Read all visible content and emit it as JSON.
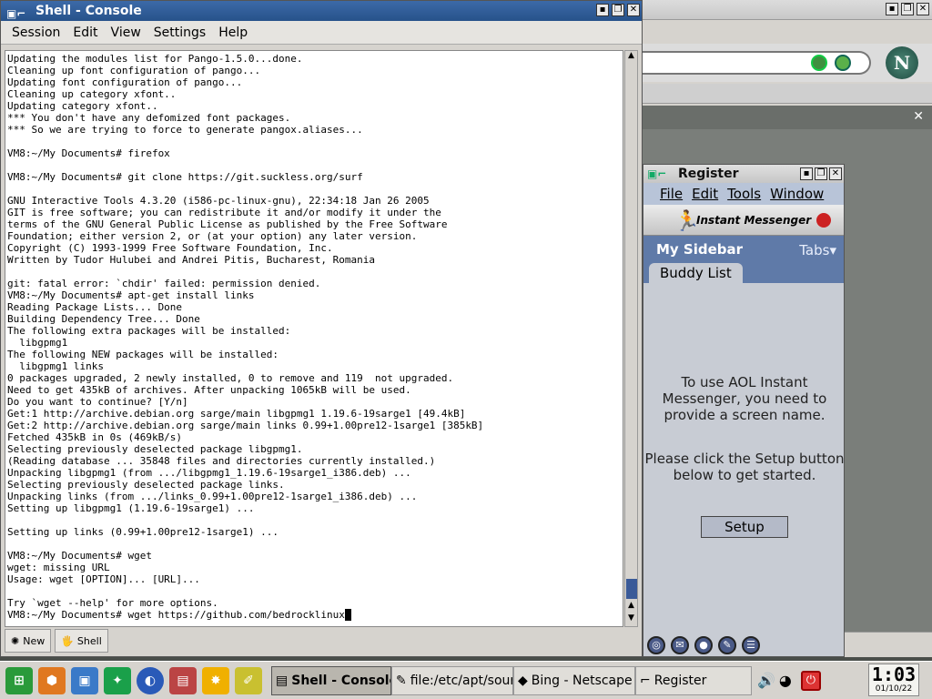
{
  "console": {
    "title": "Shell - Console",
    "menu": [
      "Session",
      "Edit",
      "View",
      "Settings",
      "Help"
    ],
    "lines": [
      "Updating the modules list for Pango-1.5.0...done.",
      "Cleaning up font configuration of pango...",
      "Updating font configuration of pango...",
      "Cleaning up category xfont..",
      "Updating category xfont..",
      "*** You don't have any defomized font packages.",
      "*** So we are trying to force to generate pangox.aliases...",
      "",
      "VM8:~/My Documents# firefox",
      "",
      "VM8:~/My Documents# git clone https://git.suckless.org/surf",
      "",
      "GNU Interactive Tools 4.3.20 (i586-pc-linux-gnu), 22:34:18 Jan 26 2005",
      "GIT is free software; you can redistribute it and/or modify it under the",
      "terms of the GNU General Public License as published by the Free Software",
      "Foundation; either version 2, or (at your option) any later version.",
      "Copyright (C) 1993-1999 Free Software Foundation, Inc.",
      "Written by Tudor Hulubei and Andrei Pitis, Bucharest, Romania",
      "",
      "git: fatal error: `chdir' failed: permission denied.",
      "VM8:~/My Documents# apt-get install links",
      "Reading Package Lists... Done",
      "Building Dependency Tree... Done",
      "The following extra packages will be installed:",
      "  libgpmg1",
      "The following NEW packages will be installed:",
      "  libgpmg1 links",
      "0 packages upgraded, 2 newly installed, 0 to remove and 119  not upgraded.",
      "Need to get 435kB of archives. After unpacking 1065kB will be used.",
      "Do you want to continue? [Y/n]",
      "Get:1 http://archive.debian.org sarge/main libgpmg1 1.19.6-19sarge1 [49.4kB]",
      "Get:2 http://archive.debian.org sarge/main links 0.99+1.00pre12-1sarge1 [385kB]",
      "Fetched 435kB in 0s (469kB/s)",
      "Selecting previously deselected package libgpmg1.",
      "(Reading database ... 35848 files and directories currently installed.)",
      "Unpacking libgpmg1 (from .../libgpmg1_1.19.6-19sarge1_i386.deb) ...",
      "Selecting previously deselected package links.",
      "Unpacking links (from .../links_0.99+1.00pre12-1sarge1_i386.deb) ...",
      "Setting up libgpmg1 (1.19.6-19sarge1) ...",
      "",
      "Setting up links (0.99+1.00pre12-1sarge1) ...",
      "",
      "VM8:~/My Documents# wget",
      "wget: missing URL",
      "Usage: wget [OPTION]... [URL]...",
      "",
      "Try `wget --help' for more options.",
      "VM8:~/My Documents# wget https://github.com/bedrocklinux"
    ],
    "tabs": [
      "New",
      "Shell"
    ]
  },
  "aim": {
    "title": "Register",
    "menu": [
      "File",
      "Edit",
      "Tools",
      "Window"
    ],
    "brand": "Instant Messenger",
    "sidebar_title": "My Sidebar",
    "tabs_label": "Tabs",
    "buddy_tab": "Buddy List",
    "message1": "To use AOL Instant Messenger, you need to provide a screen name.",
    "message2": "Please click the Setup button below to get started.",
    "setup_button": "Setup"
  },
  "netscape": {
    "logo": "N"
  },
  "taskbar": {
    "tasks": [
      "Shell - Console",
      "file:/etc/apt/sources",
      "Bing - Netscape",
      "Register"
    ],
    "time": "1:03",
    "date": "01/10/22"
  },
  "colors": {
    "console_title": "#2f5f9c",
    "aim_sidebar": "#5f7aa8",
    "desktop": "#4a4e4a"
  }
}
